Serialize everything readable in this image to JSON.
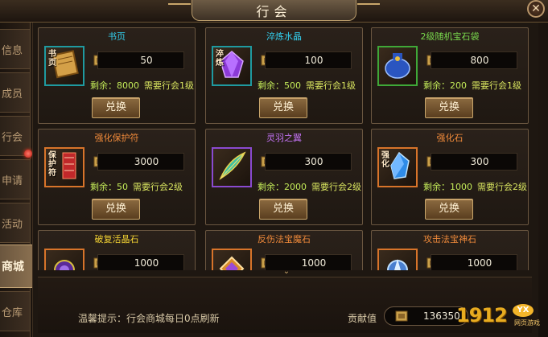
{
  "window": {
    "title": "行会",
    "close_label": "✕"
  },
  "sidebar": {
    "tabs": [
      {
        "label": "信息"
      },
      {
        "label": "成员"
      },
      {
        "label": "行会"
      },
      {
        "label": "申请"
      },
      {
        "label": "活动"
      },
      {
        "label": "商城",
        "active": true
      },
      {
        "label": "仓库"
      }
    ]
  },
  "shop": {
    "exchange_label": "兑换",
    "stock_prefix": "剩余：",
    "items": [
      {
        "name": "书页",
        "name_color": "#33d1f1",
        "icon": "book-page-icon",
        "icon_text": "书页",
        "frame": "teal",
        "price": "50",
        "stock": "8000",
        "requirement": "需要行会1级"
      },
      {
        "name": "淬炼水晶",
        "name_color": "#33d1f1",
        "icon": "purple-crystal-icon",
        "icon_text": "淬炼",
        "frame": "teal",
        "price": "100",
        "stock": "500",
        "requirement": "需要行会1级"
      },
      {
        "name": "2级随机宝石袋",
        "name_color": "#79d84d",
        "icon": "gem-bag-icon",
        "icon_text": "",
        "frame": "green",
        "price": "800",
        "stock": "200",
        "requirement": "需要行会1级"
      },
      {
        "name": "强化保护符",
        "name_color": "#f08a3a",
        "icon": "protection-charm-icon",
        "icon_text": "保护符",
        "frame": "orange",
        "price": "3000",
        "stock": "50",
        "requirement": "需要行会2级"
      },
      {
        "name": "灵羽之翼",
        "name_color": "#c071f0",
        "icon": "feather-wing-icon",
        "icon_text": "",
        "frame": "purple",
        "price": "300",
        "stock": "2000",
        "requirement": "需要行会2级"
      },
      {
        "name": "强化石",
        "name_color": "#f08a3a",
        "icon": "enhance-stone-icon",
        "icon_text": "强化",
        "frame": "orange",
        "price": "300",
        "stock": "1000",
        "requirement": "需要行会2级"
      },
      {
        "name": "破复活晶石",
        "name_color": "#f2d233",
        "icon": "revive-crystal-icon",
        "icon_text": "",
        "frame": "orange",
        "price": "1000",
        "stock": "",
        "requirement": ""
      },
      {
        "name": "反伤法宝魔石",
        "name_color": "#f08a3a",
        "icon": "reflect-stone-icon",
        "icon_text": "",
        "frame": "orange",
        "price": "1000",
        "stock": "",
        "requirement": ""
      },
      {
        "name": "攻击法宝神石",
        "name_color": "#f08a3a",
        "icon": "attack-stone-icon",
        "icon_text": "",
        "frame": "orange",
        "price": "1000",
        "stock": "",
        "requirement": ""
      }
    ]
  },
  "footer": {
    "tip": "温馨提示：行会商城每日0点刷新",
    "contribution_label": "贡献值",
    "contribution_value": "136350"
  },
  "watermark": {
    "number": "1912",
    "badge": "YX",
    "sub": "网页游戏"
  }
}
